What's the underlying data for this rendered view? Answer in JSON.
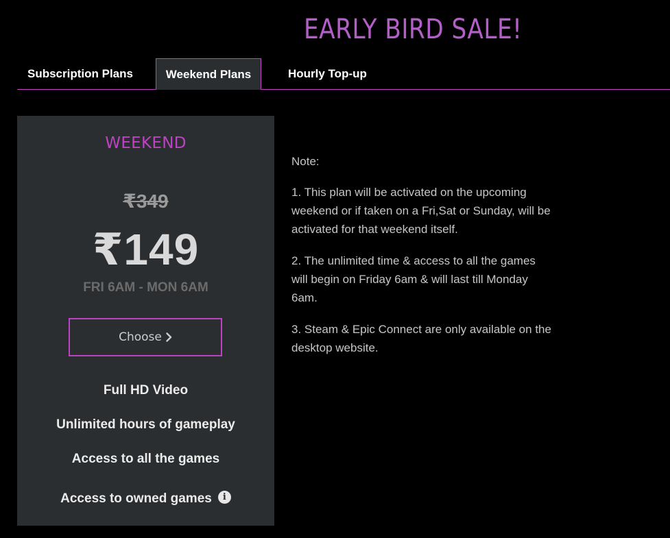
{
  "header": {
    "sale_title": "EARLY BIRD SALE!"
  },
  "tabs": [
    {
      "label": "Subscription Plans",
      "active": false
    },
    {
      "label": "Weekend Plans",
      "active": true
    },
    {
      "label": "Hourly Top-up",
      "active": false
    }
  ],
  "plan": {
    "name": "WEEKEND",
    "original_price": "₹349",
    "price": "₹149",
    "timing": "FRI 6AM - MON 6AM",
    "choose_label": "Choose",
    "features": [
      "Full HD Video",
      "Unlimited hours of gameplay",
      "Access to all the games",
      "Access to owned games"
    ],
    "info_icon": "info-circle-icon"
  },
  "notes": {
    "heading": "Note:",
    "items": [
      "1. This plan will be activated on the upcoming weekend or if taken on a Fri,Sat or Sunday, will be activated for that weekend itself.",
      "2. The unlimited time & access to all the games will begin on Friday 6am & will last till Monday 6am.",
      "3. Steam & Epic Connect are only available on the desktop website."
    ]
  },
  "colors": {
    "accent": "#c042c4",
    "title": "#b45ec9",
    "card_bg": "#2b2e30",
    "page_bg": "#000000"
  }
}
